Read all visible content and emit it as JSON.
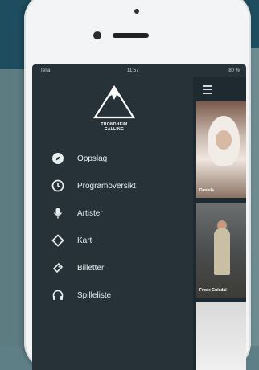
{
  "statusbar": {
    "carrier": "Telia",
    "time": "11:57",
    "battery": "80 %"
  },
  "logo": {
    "line1": "TRONDHEIM",
    "line2": "CALLING"
  },
  "menu": [
    {
      "label": "Oppslag",
      "icon": "compass-icon"
    },
    {
      "label": "Programoversikt",
      "icon": "clock-icon"
    },
    {
      "label": "Artister",
      "icon": "microphone-icon"
    },
    {
      "label": "Kart",
      "icon": "location-diamond-icon"
    },
    {
      "label": "Billetter",
      "icon": "ticket-icon"
    },
    {
      "label": "Spilleliste",
      "icon": "headphones-icon"
    }
  ],
  "cards": [
    {
      "label": "Daniela"
    },
    {
      "label": "Frode Gulsdal"
    }
  ],
  "colors": {
    "drawer_bg": "#263238",
    "text": "#e8eef0",
    "page_bg_top": "#1d4d5e"
  }
}
